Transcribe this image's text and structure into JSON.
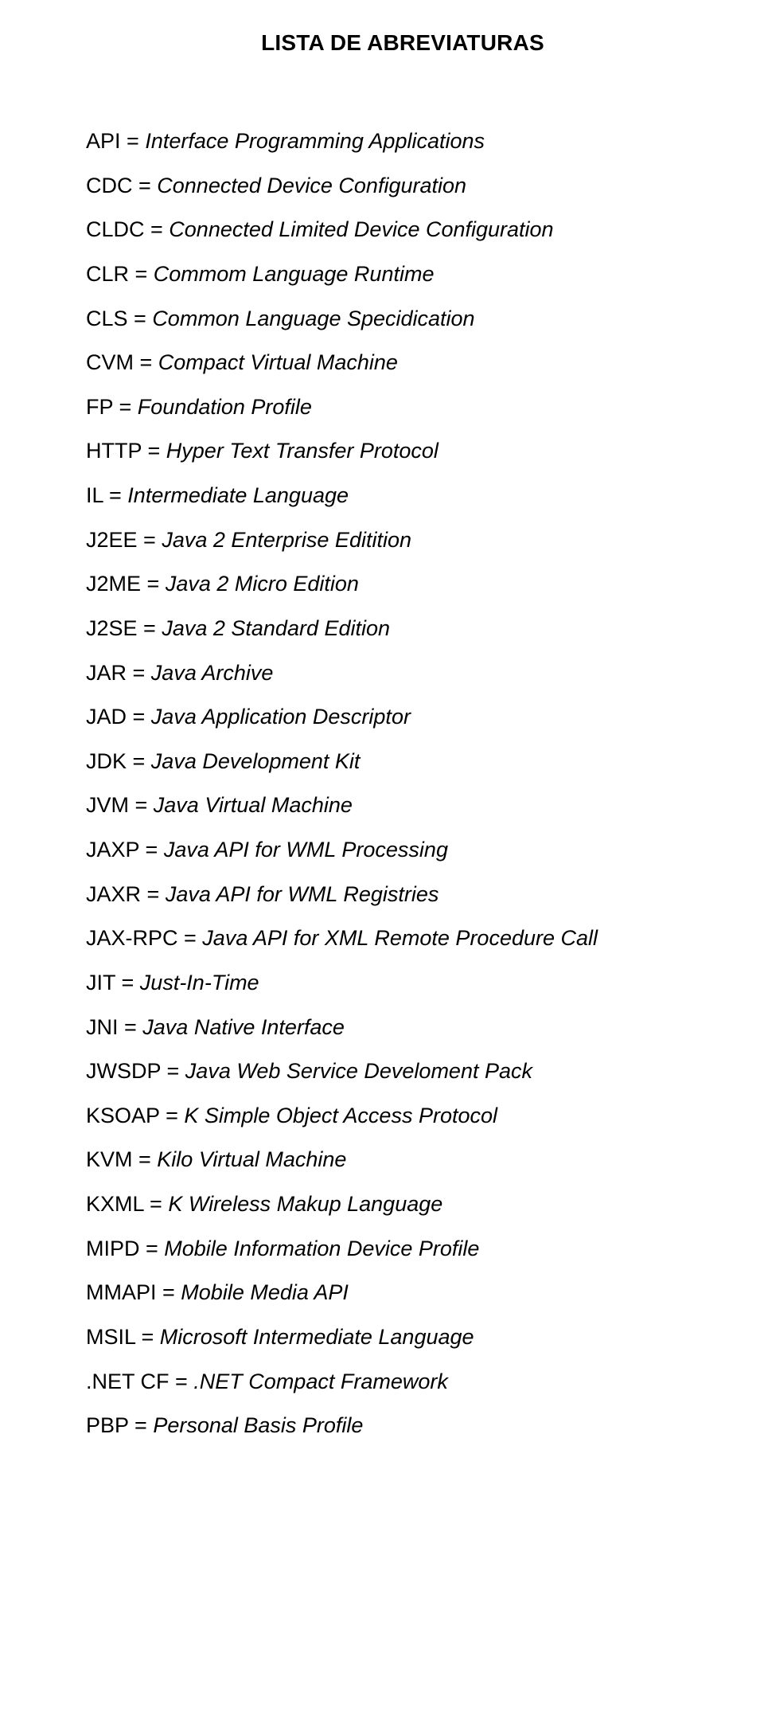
{
  "title": "LISTA DE ABREVIATURAS",
  "entries": [
    {
      "abbr": "API",
      "def": "Interface Programming Applications"
    },
    {
      "abbr": "CDC",
      "def": "Connected Device Configuration"
    },
    {
      "abbr": "CLDC",
      "def": "Connected Limited Device Configuration"
    },
    {
      "abbr": "CLR",
      "def": "Commom Language Runtime"
    },
    {
      "abbr": "CLS",
      "def": "Common Language Specidication"
    },
    {
      "abbr": "CVM",
      "def": "Compact Virtual Machine"
    },
    {
      "abbr": "FP",
      "def": "Foundation Profile"
    },
    {
      "abbr": "HTTP",
      "def": "Hyper Text Transfer Protocol"
    },
    {
      "abbr": "IL",
      "def": "Intermediate Language"
    },
    {
      "abbr": "J2EE",
      "def": "Java 2 Enterprise Editition"
    },
    {
      "abbr": "J2ME",
      "def": "Java 2 Micro Edition"
    },
    {
      "abbr": "J2SE",
      "def": "Java 2 Standard Edition"
    },
    {
      "abbr": "JAR",
      "def": "Java Archive"
    },
    {
      "abbr": "JAD",
      "def": "Java Application Descriptor"
    },
    {
      "abbr": "JDK",
      "def": "Java Development Kit"
    },
    {
      "abbr": "JVM",
      "def": "Java Virtual Machine"
    },
    {
      "abbr": "JAXP",
      "def": "Java API for WML Processing"
    },
    {
      "abbr": "JAXR",
      "def": "Java API for WML Registries"
    },
    {
      "abbr": "JAX-RPC",
      "def": "Java API for XML Remote Procedure Call"
    },
    {
      "abbr": "JIT",
      "def": " Just-In-Time"
    },
    {
      "abbr": "JNI",
      "def": "Java Native Interface"
    },
    {
      "abbr": "JWSDP",
      "def": "Java Web Service Develoment Pack"
    },
    {
      "abbr": "KSOAP",
      "def": "K Simple Object Access Protocol"
    },
    {
      "abbr": "KVM",
      "def": "Kilo Virtual Machine"
    },
    {
      "abbr": "KXML",
      "def": "K Wireless Makup Language"
    },
    {
      "abbr": "MIPD",
      "def": "Mobile Information Device Profile"
    },
    {
      "abbr": "MMAPI",
      "def": "Mobile Media API"
    },
    {
      "abbr": "MSIL",
      "def": "Microsoft Intermediate Language"
    },
    {
      "abbr": ".NET CF",
      "def": ".NET Compact Framework"
    },
    {
      "abbr": "PBP",
      "def": "Personal Basis Profile"
    }
  ],
  "equals": " = "
}
